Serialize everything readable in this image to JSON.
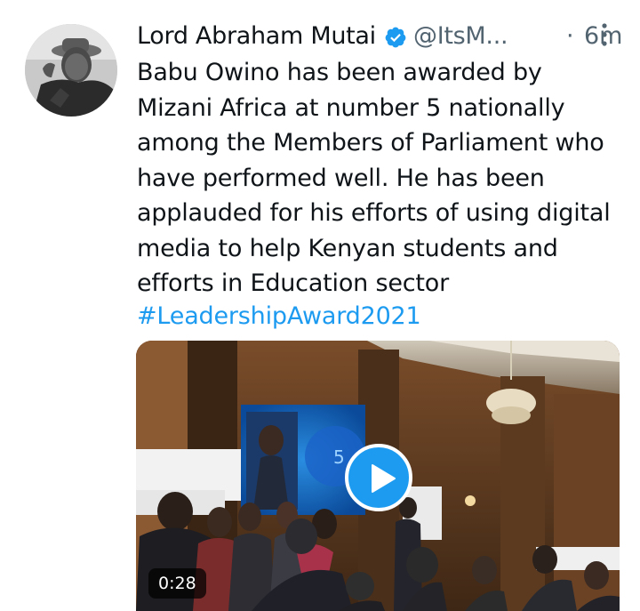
{
  "tweet": {
    "author": {
      "display_name": "Lord Abraham Mutai",
      "handle": "@ItsM...",
      "verified_icon": "verified-badge-icon",
      "avatar": "avatar"
    },
    "separator": "·",
    "time": "6m",
    "more_icon": "more-options-icon",
    "mention": "Babu Owino",
    "text_rest": " has been awarded by Mizani Africa at number 5 nationally among the Members of Parliament who have performed well. He has been applauded for his efforts of using digital media to help Kenyan students and efforts in Education sector",
    "hashtag": "#LeadershipAward2021",
    "media": {
      "play_icon": "play-icon",
      "duration": "0:28"
    }
  },
  "colors": {
    "accent": "#1d9bf0",
    "text": "#0f1419",
    "secondary": "#536471"
  }
}
